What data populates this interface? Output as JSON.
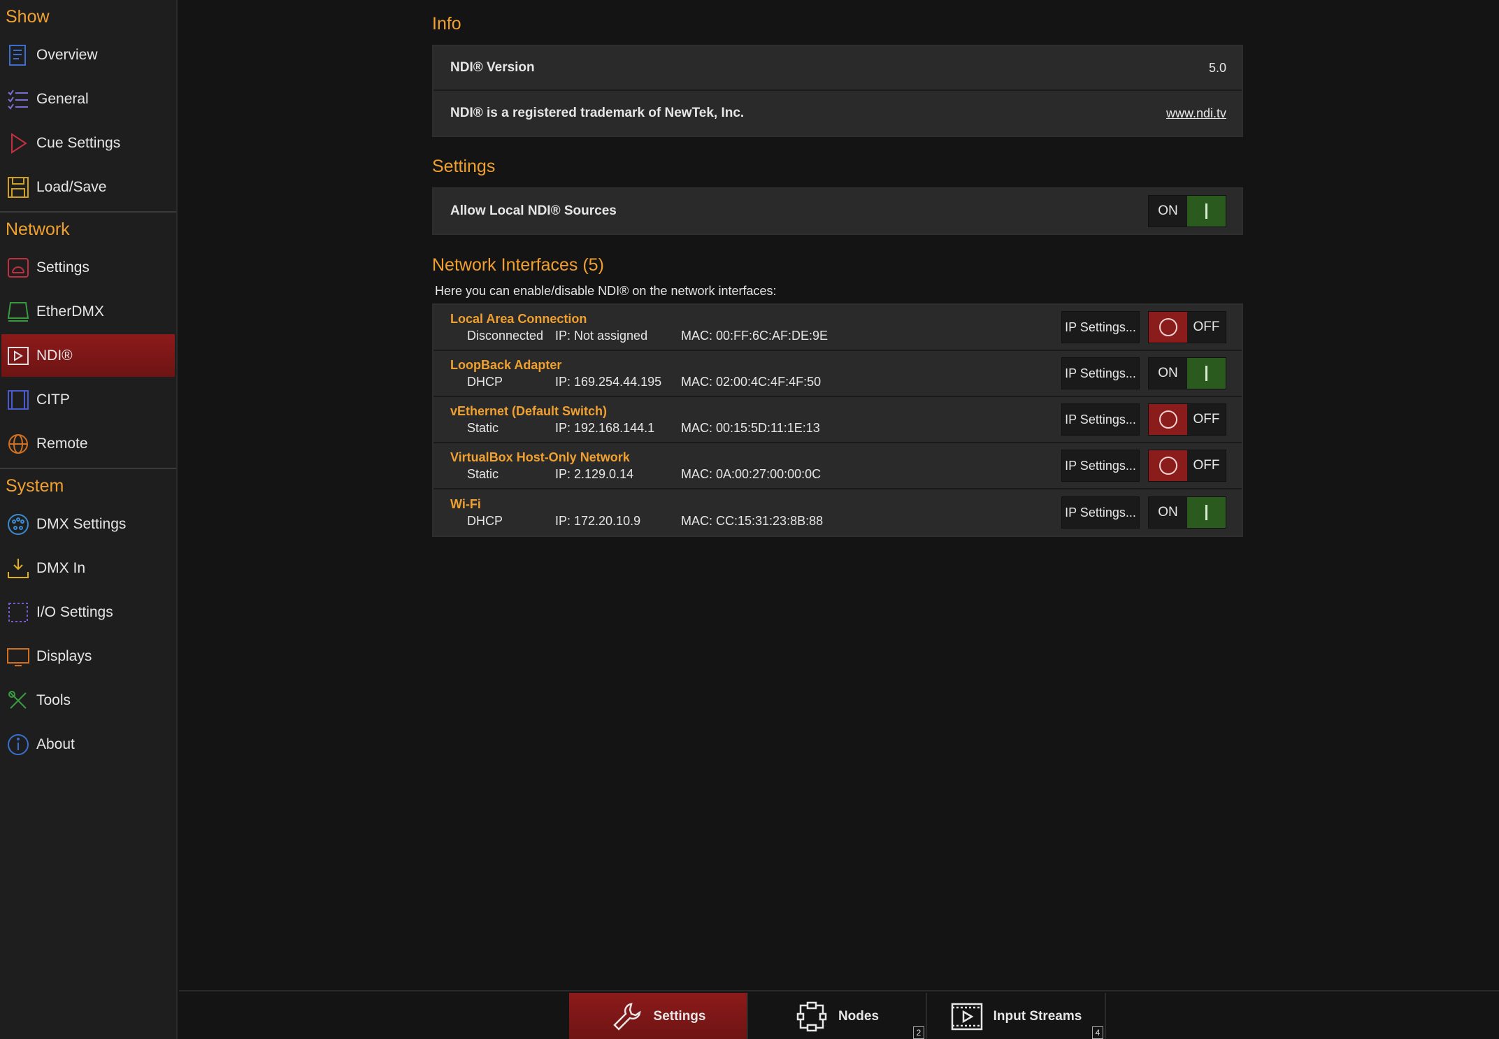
{
  "sidebar": {
    "sections": [
      {
        "title": "Show",
        "items": [
          {
            "label": "Overview",
            "icon": "overview-icon"
          },
          {
            "label": "General",
            "icon": "general-icon"
          },
          {
            "label": "Cue Settings",
            "icon": "cue-settings-icon"
          },
          {
            "label": "Load/Save",
            "icon": "load-save-icon"
          }
        ]
      },
      {
        "title": "Network",
        "items": [
          {
            "label": "Settings",
            "icon": "network-settings-icon"
          },
          {
            "label": "EtherDMX",
            "icon": "etherdmx-icon"
          },
          {
            "label": "NDI®",
            "icon": "ndi-icon"
          },
          {
            "label": "CITP",
            "icon": "citp-icon"
          },
          {
            "label": "Remote",
            "icon": "remote-icon"
          }
        ]
      },
      {
        "title": "System",
        "items": [
          {
            "label": "DMX Settings",
            "icon": "dmx-settings-icon"
          },
          {
            "label": "DMX In",
            "icon": "dmx-in-icon"
          },
          {
            "label": "I/O Settings",
            "icon": "io-settings-icon"
          },
          {
            "label": "Displays",
            "icon": "displays-icon"
          },
          {
            "label": "Tools",
            "icon": "tools-icon"
          },
          {
            "label": "About",
            "icon": "about-icon"
          }
        ]
      }
    ],
    "active": "NDI®"
  },
  "info": {
    "title": "Info",
    "version_label": "NDI® Version",
    "version_value": "5.0",
    "trademark_label": "NDI® is a registered trademark of NewTek, Inc.",
    "trademark_link": "www.ndi.tv"
  },
  "settings": {
    "title": "Settings",
    "allow_local_label": "Allow Local NDI® Sources",
    "allow_local_state": "ON"
  },
  "interfaces": {
    "title": "Network Interfaces (5)",
    "description": "Here you can enable/disable NDI® on the network interfaces:",
    "ip_button_label": "IP Settings...",
    "items": [
      {
        "name": "Local Area Connection",
        "mode": "Disconnected",
        "ip": "IP: Not assigned",
        "mac": "MAC: 00:FF:6C:AF:DE:9E",
        "state": "OFF"
      },
      {
        "name": "LoopBack Adapter",
        "mode": "DHCP",
        "ip": "IP: 169.254.44.195",
        "mac": "MAC: 02:00:4C:4F:4F:50",
        "state": "ON"
      },
      {
        "name": "vEthernet (Default Switch)",
        "mode": "Static",
        "ip": "IP: 192.168.144.1",
        "mac": "MAC: 00:15:5D:11:1E:13",
        "state": "OFF"
      },
      {
        "name": "VirtualBox Host-Only Network",
        "mode": "Static",
        "ip": "IP: 2.129.0.14",
        "mac": "MAC: 0A:00:27:00:00:0C",
        "state": "OFF"
      },
      {
        "name": "Wi-Fi",
        "mode": "DHCP",
        "ip": "IP: 172.20.10.9",
        "mac": "MAC: CC:15:31:23:8B:88",
        "state": "ON"
      }
    ]
  },
  "bottombar": {
    "tabs": [
      {
        "label": "Settings",
        "icon": "wrench-icon",
        "badge": ""
      },
      {
        "label": "Nodes",
        "icon": "nodes-icon",
        "badge": "2"
      },
      {
        "label": "Input Streams",
        "icon": "input-streams-icon",
        "badge": "4"
      }
    ],
    "active": "Settings"
  },
  "colors": {
    "accent": "#f0a030",
    "active_bg": "#8c1a1a",
    "on_green": "#2a5a1e",
    "off_red": "#8a1c1c"
  }
}
